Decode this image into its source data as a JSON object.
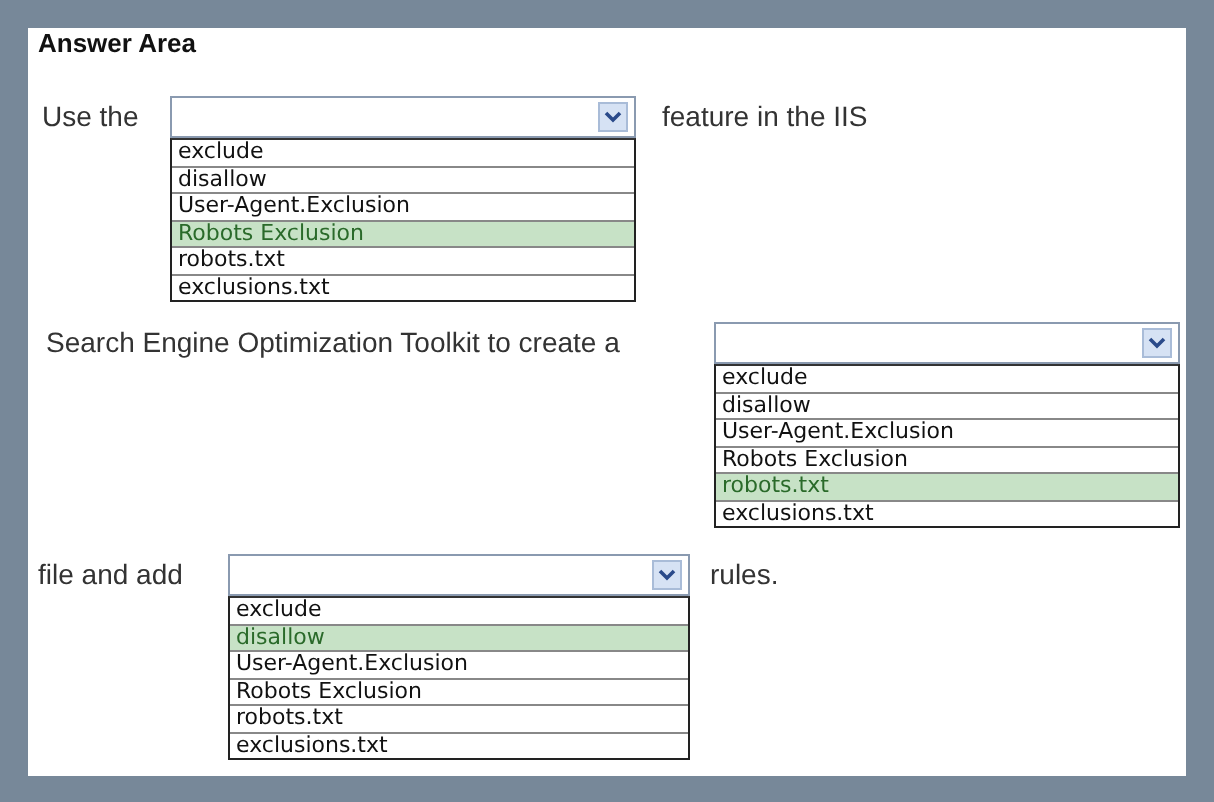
{
  "title": "Answer Area",
  "rows": [
    {
      "before": "Use the",
      "after": "feature in the IIS",
      "options": [
        {
          "label": "exclude",
          "selected": false
        },
        {
          "label": "disallow",
          "selected": false
        },
        {
          "label": "User-Agent.Exclusion",
          "selected": false
        },
        {
          "label": "Robots Exclusion",
          "selected": true
        },
        {
          "label": "robots.txt",
          "selected": false
        },
        {
          "label": "exclusions.txt",
          "selected": false
        }
      ]
    },
    {
      "before": "Search Engine Optimization Toolkit to create a",
      "options": [
        {
          "label": "exclude",
          "selected": false
        },
        {
          "label": "disallow",
          "selected": false
        },
        {
          "label": "User-Agent.Exclusion",
          "selected": false
        },
        {
          "label": "Robots Exclusion",
          "selected": false
        },
        {
          "label": "robots.txt",
          "selected": true
        },
        {
          "label": "exclusions.txt",
          "selected": false
        }
      ]
    },
    {
      "before": "file and add",
      "after": "rules.",
      "options": [
        {
          "label": "exclude",
          "selected": false
        },
        {
          "label": "disallow",
          "selected": true
        },
        {
          "label": "User-Agent.Exclusion",
          "selected": false
        },
        {
          "label": "Robots Exclusion",
          "selected": false
        },
        {
          "label": "robots.txt",
          "selected": false
        },
        {
          "label": "exclusions.txt",
          "selected": false
        }
      ]
    }
  ]
}
